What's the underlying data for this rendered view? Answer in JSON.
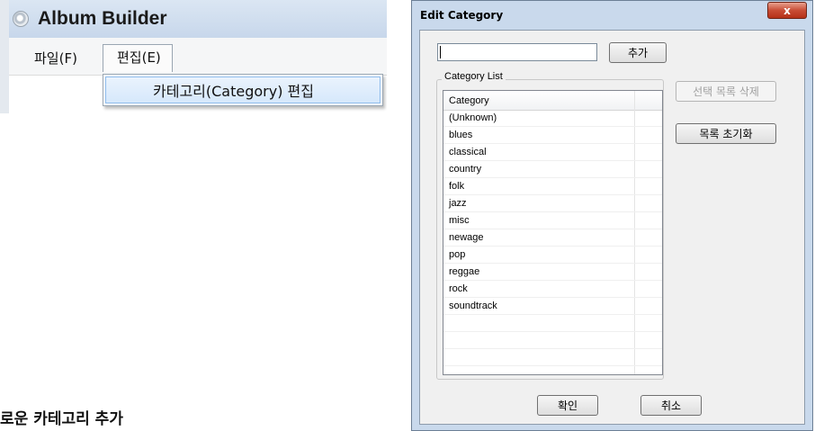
{
  "app": {
    "title": "Album Builder",
    "menu": {
      "file": "파일(F)",
      "edit": "편집(E)"
    },
    "dropdown": {
      "edit_category": "카테고리(Category) 편집"
    }
  },
  "caption": "로운 카테고리 추가",
  "dialog": {
    "title": "Edit Category",
    "close_label": "x",
    "input_value": "",
    "add_button": "추가",
    "group_label": "Category List",
    "list_header": "Category",
    "categories": [
      "(Unknown)",
      "blues",
      "classical",
      "country",
      "folk",
      "jazz",
      "misc",
      "newage",
      "pop",
      "reggae",
      "rock",
      "soundtrack",
      "",
      "",
      "",
      ""
    ],
    "delete_button": "선택 목록 삭제",
    "reset_button": "목록 초기화",
    "ok_button": "확인",
    "cancel_button": "취소"
  }
}
